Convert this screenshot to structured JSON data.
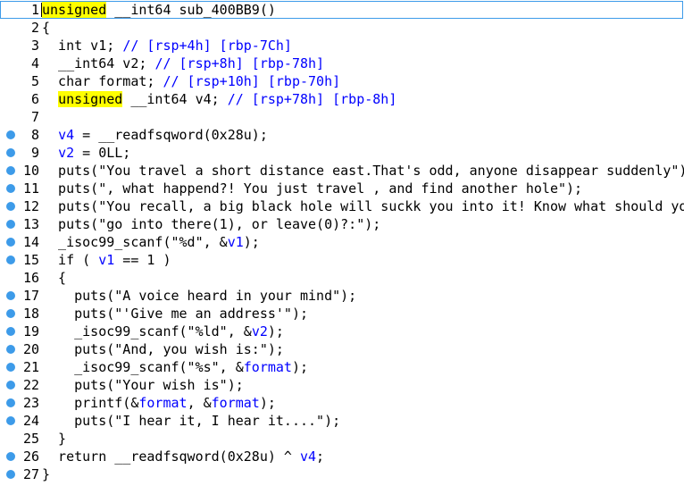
{
  "viewer": {
    "colors": {
      "background": "#ffffff",
      "text": "#000000",
      "variable": "#0000ff",
      "comment": "#0000ff",
      "highlight": "#ffff00",
      "breakpoint": "#3d9be9",
      "current_line_border": "#3d9be9"
    },
    "breakpoint_icon": "breakpoint-dot-icon",
    "lines": [
      {
        "n": "1",
        "bp": false,
        "parts": [
          {
            "t": "unsigned",
            "c": "hl"
          },
          {
            "t": " __int64 sub_400BB9()"
          }
        ]
      },
      {
        "n": "2",
        "bp": false,
        "parts": [
          {
            "t": "{"
          }
        ]
      },
      {
        "n": "3",
        "bp": false,
        "parts": [
          {
            "t": "  int v1; "
          },
          {
            "t": "// [rsp+4h] [rbp-7Ch]",
            "c": "cmt"
          }
        ]
      },
      {
        "n": "4",
        "bp": false,
        "parts": [
          {
            "t": "  __int64 v2; "
          },
          {
            "t": "// [rsp+8h] [rbp-78h]",
            "c": "cmt"
          }
        ]
      },
      {
        "n": "5",
        "bp": false,
        "parts": [
          {
            "t": "  char format; "
          },
          {
            "t": "// [rsp+10h] [rbp-70h]",
            "c": "cmt"
          }
        ]
      },
      {
        "n": "6",
        "bp": false,
        "parts": [
          {
            "t": "  "
          },
          {
            "t": "unsigned",
            "c": "hl"
          },
          {
            "t": " __int64 v4; "
          },
          {
            "t": "// [rsp+78h] [rbp-8h]",
            "c": "cmt"
          }
        ]
      },
      {
        "n": "7",
        "bp": false,
        "parts": [
          {
            "t": ""
          }
        ]
      },
      {
        "n": "8",
        "bp": true,
        "parts": [
          {
            "t": "  "
          },
          {
            "t": "v4",
            "c": "var"
          },
          {
            "t": " = __readfsqword(0x28u);"
          }
        ]
      },
      {
        "n": "9",
        "bp": true,
        "parts": [
          {
            "t": "  "
          },
          {
            "t": "v2",
            "c": "var"
          },
          {
            "t": " = 0LL;"
          }
        ]
      },
      {
        "n": "10",
        "bp": true,
        "parts": [
          {
            "t": "  puts(\"You travel a short distance east.That's odd, anyone disappear suddenly\");"
          }
        ]
      },
      {
        "n": "11",
        "bp": true,
        "parts": [
          {
            "t": "  puts(\", what happend?! You just travel , and find another hole\");"
          }
        ]
      },
      {
        "n": "12",
        "bp": true,
        "parts": [
          {
            "t": "  puts(\"You recall, a big black hole will suckk you into it! Know what should you do?\");"
          }
        ]
      },
      {
        "n": "13",
        "bp": true,
        "parts": [
          {
            "t": "  puts(\"go into there(1), or leave(0)?:\");"
          }
        ]
      },
      {
        "n": "14",
        "bp": true,
        "parts": [
          {
            "t": "  _isoc99_scanf(\"%d\", &"
          },
          {
            "t": "v1",
            "c": "var"
          },
          {
            "t": ");"
          }
        ]
      },
      {
        "n": "15",
        "bp": true,
        "parts": [
          {
            "t": "  if ( "
          },
          {
            "t": "v1",
            "c": "var"
          },
          {
            "t": " == 1 )"
          }
        ]
      },
      {
        "n": "16",
        "bp": false,
        "parts": [
          {
            "t": "  {"
          }
        ]
      },
      {
        "n": "17",
        "bp": true,
        "parts": [
          {
            "t": "    puts(\"A voice heard in your mind\");"
          }
        ]
      },
      {
        "n": "18",
        "bp": true,
        "parts": [
          {
            "t": "    puts(\"'Give me an address'\");"
          }
        ]
      },
      {
        "n": "19",
        "bp": true,
        "parts": [
          {
            "t": "    _isoc99_scanf(\"%ld\", &"
          },
          {
            "t": "v2",
            "c": "var"
          },
          {
            "t": ");"
          }
        ]
      },
      {
        "n": "20",
        "bp": true,
        "parts": [
          {
            "t": "    puts(\"And, you wish is:\");"
          }
        ]
      },
      {
        "n": "21",
        "bp": true,
        "parts": [
          {
            "t": "    _isoc99_scanf(\"%s\", &"
          },
          {
            "t": "format",
            "c": "var"
          },
          {
            "t": ");"
          }
        ]
      },
      {
        "n": "22",
        "bp": true,
        "parts": [
          {
            "t": "    puts(\"Your wish is\");"
          }
        ]
      },
      {
        "n": "23",
        "bp": true,
        "parts": [
          {
            "t": "    printf(&"
          },
          {
            "t": "format",
            "c": "var"
          },
          {
            "t": ", &"
          },
          {
            "t": "format",
            "c": "var"
          },
          {
            "t": ");"
          }
        ]
      },
      {
        "n": "24",
        "bp": true,
        "parts": [
          {
            "t": "    puts(\"I hear it, I hear it....\");"
          }
        ]
      },
      {
        "n": "25",
        "bp": false,
        "parts": [
          {
            "t": "  }"
          }
        ]
      },
      {
        "n": "26",
        "bp": true,
        "parts": [
          {
            "t": "  return __readfsqword(0x28u) ^ "
          },
          {
            "t": "v4",
            "c": "var"
          },
          {
            "t": ";"
          }
        ]
      },
      {
        "n": "27",
        "bp": true,
        "parts": [
          {
            "t": "}"
          }
        ]
      }
    ]
  }
}
